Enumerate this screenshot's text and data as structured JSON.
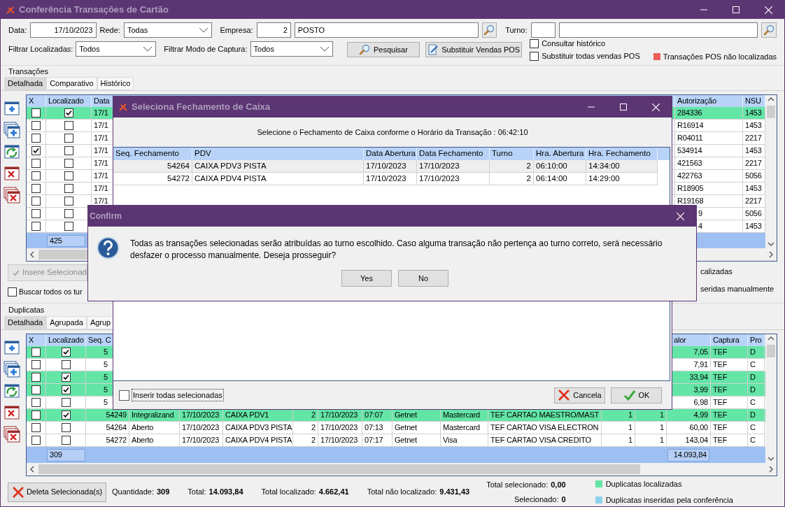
{
  "window": {
    "title": "Conferência Transações de Cartão"
  },
  "filters": {
    "data_label": "Data:",
    "data": "17/10/2023",
    "rede_label": "Rede:",
    "rede": "Todas",
    "empresa_label": "Empresa:",
    "empresa_code": "2",
    "empresa_name": "POSTO",
    "turno_label": "Turno:",
    "localizadas_label": "Filtrar Localizadas:",
    "localizadas": "Todos",
    "captura_label": "Filtrar Modo de Captura:",
    "captura": "Todos"
  },
  "buttons": {
    "pesquisar": "Pesquisar",
    "substituir": "Substituir Vendas POS"
  },
  "options": [
    {
      "label": "Consultar histórico",
      "checked": false
    },
    {
      "label": "Substituir todas vendas POS",
      "checked": false
    }
  ],
  "pos_legend": {
    "label": "Transações POS não localizadas",
    "color": "#ef5f5a"
  },
  "transacoes": {
    "title": "Transações",
    "tabs": [
      {
        "label": "Detalhada",
        "selected": true
      },
      {
        "label": "Comparativo",
        "selected": false
      },
      {
        "label": "Histórico",
        "selected": false
      }
    ],
    "header": {
      "x": "X",
      "localizado": "Localizado",
      "data": "Data",
      "autorizacao": "Autorização",
      "nsu": "NSU"
    },
    "rows": [
      {
        "x": false,
        "localizado": true,
        "data": "17/1",
        "autorizacao": "284336",
        "nsu": "1453",
        "covered": false
      },
      {
        "x": false,
        "localizado": false,
        "data": "17/1",
        "autorizacao": "R16914",
        "nsu": "1453",
        "covered": false
      },
      {
        "x": false,
        "localizado": false,
        "data": "17/1",
        "autorizacao": "R04011",
        "nsu": "2217",
        "covered": false
      },
      {
        "x": true,
        "localizado": false,
        "data": "17/1",
        "autorizacao": "534914",
        "nsu": "1453",
        "covered": false
      },
      {
        "x": false,
        "localizado": false,
        "data": "17/1",
        "autorizacao": "421563",
        "nsu": "2217",
        "covered": false
      },
      {
        "x": false,
        "localizado": false,
        "data": "17/1",
        "autorizacao": "422763",
        "nsu": "5056",
        "covered": false
      },
      {
        "x": false,
        "localizado": false,
        "data": "17/1",
        "autorizacao": "R18905",
        "nsu": "1453",
        "covered": false
      },
      {
        "x": false,
        "localizado": false,
        "data": "17/1",
        "autorizacao": "R19168",
        "nsu": "2217",
        "covered": false
      },
      {
        "x": false,
        "localizado": false,
        "autorizacao": "9",
        "nsu": "5056",
        "covered": true
      },
      {
        "x": false,
        "localizado": false,
        "autorizacao": "4",
        "nsu": "1453",
        "covered": true
      }
    ],
    "footer": "425",
    "insert_button": {
      "label": "Insere Selecionad",
      "disabled": true
    },
    "search_all": {
      "label": "Buscar todos os tur",
      "checked": false
    },
    "legend": [
      "calizadas",
      "seridas manualmente"
    ]
  },
  "duplicatas": {
    "title": "Duplicatas",
    "tabs": [
      {
        "label": "Detalhada",
        "selected": true
      },
      {
        "label": "Agrupada",
        "selected": false
      },
      {
        "label": "Agrup",
        "selected": false
      }
    ],
    "header": {
      "x": "X",
      "localizado": "Localizado",
      "seq": "Seq. C",
      "valor": "alor",
      "captura": "Captura",
      "proc": "Pro"
    },
    "rows": [
      {
        "x": false,
        "localizado": true,
        "seq": "5",
        "valor": "7,05",
        "captura": "TEF",
        "proc": "D",
        "covered": true
      },
      {
        "x": false,
        "localizado": false,
        "seq": "5",
        "valor": "7,91",
        "captura": "TEF",
        "proc": "C",
        "covered": true
      },
      {
        "x": false,
        "localizado": true,
        "seq": "5",
        "valor": "33,94",
        "captura": "TEF",
        "proc": "D",
        "covered": true
      },
      {
        "x": false,
        "localizado": true,
        "seq": "5",
        "valor": "3,99",
        "captura": "TEF",
        "proc": "D",
        "covered": true
      },
      {
        "x": false,
        "localizado": false,
        "seq": "5",
        "valor": "6,98",
        "captura": "TEF",
        "proc": "C",
        "covered": true
      },
      {
        "x": false,
        "localizado": true,
        "seq": "54249",
        "status": "Integralizand",
        "data": "17/10/2023",
        "pdv": "CAIXA PDV1",
        "turno": "2",
        "data_abertura": "17/10/2023",
        "hora": "07:07",
        "rede": "Getnet",
        "bandeira": "Mastercard",
        "produto": "TEF CARTAO MAESTRO/MAST",
        "column_13": "1",
        "column_14": "1",
        "valor": "4,99",
        "captura": "TEF",
        "proc": "D",
        "covered": false
      },
      {
        "x": false,
        "localizado": false,
        "seq": "54264",
        "status": "Aberto",
        "data": "17/10/2023",
        "pdv": "CAIXA PDV3 PISTA",
        "turno": "2",
        "data_abertura": "17/10/2023",
        "hora": "07:13",
        "rede": "Getnet",
        "bandeira": "Mastercard",
        "produto": "TEF CARTAO VISA ELECTRON",
        "column_13": "1",
        "column_14": "1",
        "valor": "60,00",
        "captura": "TEF",
        "proc": "C",
        "covered": false
      },
      {
        "x": false,
        "localizado": false,
        "seq": "54272",
        "status": "Aberto",
        "data": "17/10/2023",
        "pdv": "CAIXA PDV4 PISTA",
        "turno": "2",
        "data_abertura": "17/10/2023",
        "hora": "07:17",
        "rede": "Getnet",
        "bandeira": "Visa",
        "produto": "TEF CARTAO VISA CREDITO",
        "column_13": "1",
        "column_14": "1",
        "valor": "143,04",
        "captura": "TEF",
        "proc": "C",
        "covered": false
      }
    ],
    "footer_count": "309",
    "footer_total": "14.093,84"
  },
  "bottom": {
    "delete_button": "Deleta Selecionada(s)",
    "totals": [
      {
        "label": "Quantidade:",
        "value": "309"
      },
      {
        "label": "Total:",
        "value": "14.093,84"
      },
      {
        "label": "Total localizado:",
        "value": "4.662,41"
      },
      {
        "label": "Total não localizado:",
        "value": "9.431,43"
      }
    ],
    "selected": [
      {
        "label": "Total selecionado:",
        "value": "0,00"
      },
      {
        "label": "Selecionado:",
        "value": "0"
      }
    ],
    "legend": [
      {
        "label": "Duplicatas localizadas",
        "color": "#63e5a6"
      },
      {
        "label": "Duplicatas inseridas pela conferência",
        "color": "#8ed2ec"
      }
    ]
  },
  "seleciona_dialog": {
    "title": "Seleciona Fechamento de Caixa",
    "message": "Selecione o Fechamento de Caixa conforme o Horário da Transação : 06:42:10",
    "columns": [
      "Seq. Fechamento",
      "PDV",
      "Data Abertura",
      "Data Fechamento",
      "Turno",
      "Hra. Abertura",
      "Hra. Fechamento"
    ],
    "rows": [
      {
        "cells": [
          "54264",
          "CAIXA PDV3 PISTA",
          "17/10/2023",
          "17/10/2023",
          "2",
          "06:10:00",
          "14:34:00"
        ],
        "selected": true
      },
      {
        "cells": [
          "54272",
          "CAIXA PDV4 PISTA",
          "17/10/2023",
          "17/10/2023",
          "2",
          "06:14:00",
          "14:29:00"
        ],
        "selected": false
      }
    ],
    "insert_all": {
      "label": "Inserir todas selecionadas",
      "checked": false
    },
    "cancel": "Cancela",
    "ok": "OK"
  },
  "confirm_dialog": {
    "title": "Confirm",
    "message": "Todas as transações selecionadas serão atribuídas ao turno escolhido. Caso alguma transação não pertença ao turno correto, será necessário desfazer o processo manualmente. Deseja prosseguir?",
    "buttons": [
      "Yes",
      "No"
    ]
  }
}
